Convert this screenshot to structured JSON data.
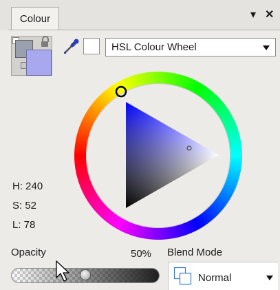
{
  "panel": {
    "tab_label": "Colour",
    "menu_arrow": "▾",
    "close_glyph": "✕"
  },
  "toolbar": {
    "mode_selected": "HSL Colour Wheel"
  },
  "colors": {
    "current": "#a8a8ee",
    "previous": "#9aa0ad",
    "accent": "#2a3eb1"
  },
  "hsl": {
    "h": "H: 240",
    "s": "S: 52",
    "l": "L: 78"
  },
  "opacity": {
    "label": "Opacity",
    "value_text": "50%",
    "level": 0.5
  },
  "blend": {
    "label": "Blend Mode",
    "value": "Normal"
  }
}
